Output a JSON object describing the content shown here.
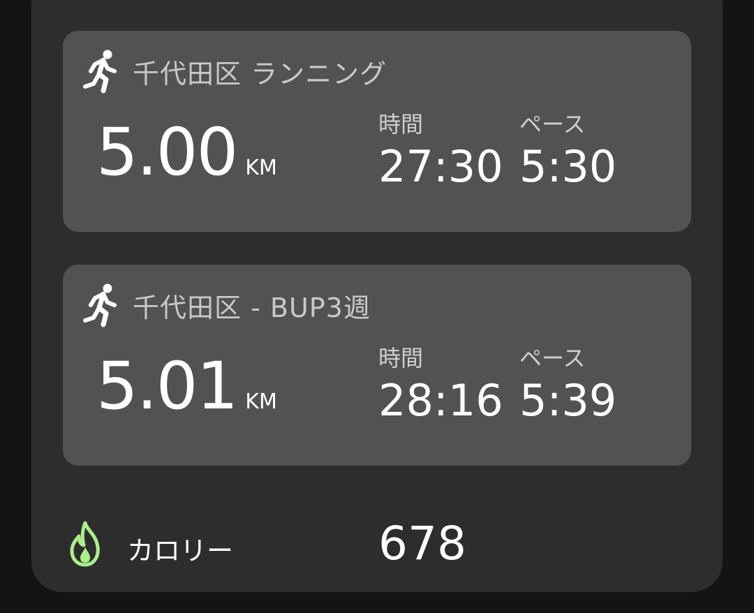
{
  "activities": [
    {
      "icon": "running-person-icon",
      "title": "千代田区 ランニング",
      "distance": "5.00",
      "distance_unit": "KM",
      "time_label": "時間",
      "time_value": "27:30",
      "pace_label": "ペース",
      "pace_value": "5:30"
    },
    {
      "icon": "running-person-icon",
      "title": "千代田区 - BUP3週",
      "distance": "5.01",
      "distance_unit": "KM",
      "time_label": "時間",
      "time_value": "28:16",
      "pace_label": "ペース",
      "pace_value": "5:39"
    }
  ],
  "calories": {
    "icon": "flame-icon",
    "label": "カロリー",
    "value": "678"
  },
  "colors": {
    "background": "#141414",
    "panel": "#2d2d2d",
    "card": "#525252",
    "text": "#ffffff",
    "muted_text": "#c9c9c9",
    "flame": "#a9f08a"
  }
}
